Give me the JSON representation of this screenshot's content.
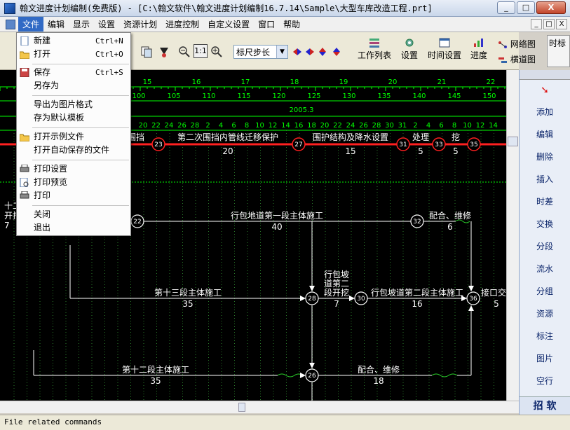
{
  "window": {
    "title": "翰文进度计划编制(免费版) - [C:\\翰文软件\\翰文进度计划编制16.7.14\\Sample\\大型车库改造工程.prt]",
    "min": "_",
    "max": "□",
    "close": "X"
  },
  "menu": {
    "items": [
      "文件",
      "编辑",
      "显示",
      "设置",
      "资源计划",
      "进度控制",
      "自定义设置",
      "窗口",
      "帮助"
    ],
    "mdi": [
      "_",
      "□",
      "X"
    ]
  },
  "file_menu": {
    "items": [
      {
        "label": "新建",
        "shortcut": "Ctrl+N",
        "icon": "new-file-icon"
      },
      {
        "label": "打开",
        "shortcut": "Ctrl+O",
        "icon": "open-folder-icon"
      },
      {
        "label": "保存",
        "shortcut": "Ctrl+S",
        "icon": "save-icon"
      },
      {
        "label": "另存为",
        "shortcut": "",
        "icon": ""
      },
      {
        "label": "导出为图片格式",
        "shortcut": "",
        "icon": ""
      },
      {
        "label": "存为默认模板",
        "shortcut": "",
        "icon": ""
      },
      {
        "label": "打开示例文件",
        "shortcut": "",
        "icon": "open-folder-icon"
      },
      {
        "label": "打开自动保存的文件",
        "shortcut": "",
        "icon": ""
      },
      {
        "label": "打印设置",
        "shortcut": "",
        "icon": "printer-icon"
      },
      {
        "label": "打印预览",
        "shortcut": "",
        "icon": "preview-icon"
      },
      {
        "label": "打印",
        "shortcut": "",
        "icon": "printer-icon"
      },
      {
        "label": "关闭",
        "shortcut": "",
        "icon": ""
      },
      {
        "label": "退出",
        "shortcut": "",
        "icon": ""
      }
    ]
  },
  "toolbar": {
    "zoom_11": "1:1",
    "ruler_select": "标尺步长",
    "work_list": "工作列表",
    "settings": "设置",
    "time_settings": "时间设置",
    "progress": "进度",
    "network": "网络图",
    "bar_chart": "横道图",
    "right_cut": "时标"
  },
  "right_panel": {
    "items": [
      "添加",
      "编辑",
      "删除",
      "插入",
      "时差",
      "交换",
      "分段",
      "流水",
      "分组",
      "资源",
      "标注",
      "图片",
      "空行"
    ],
    "bottom": "招 软"
  },
  "timeline": {
    "week_labels": [
      "15",
      "16",
      "17",
      "18",
      "19",
      "20",
      "21",
      "22"
    ],
    "day_labels": [
      "100",
      "105",
      "110",
      "115",
      "120",
      "125",
      "130",
      "135",
      "140",
      "145",
      "150"
    ],
    "month_label": "2005.3",
    "date_labels": [
      "20",
      "22",
      "24",
      "26",
      "28",
      "2",
      "4",
      "6",
      "8",
      "10",
      "12",
      "14",
      "16",
      "18",
      "20",
      "22",
      "24",
      "26",
      "28",
      "30",
      "31",
      "2",
      "4",
      "6",
      "8",
      "10",
      "12",
      "14"
    ]
  },
  "network": {
    "critical_tasks": [
      {
        "name": "围挡",
        "duration": ""
      },
      {
        "name": "第二次围挡内管线迁移保护",
        "duration": "20"
      },
      {
        "name": "围护结构及降水设置",
        "duration": "15"
      },
      {
        "name": "处理",
        "duration": "5"
      },
      {
        "name": "挖",
        "duration": "5"
      }
    ],
    "critical_nodes": [
      "23",
      "27",
      "31",
      "33",
      "35"
    ],
    "tasks": [
      {
        "name": "行包地道第一段主体施工",
        "duration": "40"
      },
      {
        "name": "配合、维修",
        "duration": "6"
      },
      {
        "name": "第十三段主体施工",
        "duration": "35"
      },
      {
        "name": "行包坡",
        "duration": ""
      },
      {
        "name": "道第二",
        "duration": ""
      },
      {
        "name": "段开挖",
        "duration": "7"
      },
      {
        "name": "行包坡道第二段主体施工",
        "duration": "16"
      },
      {
        "name": "接口交",
        "duration": "5"
      },
      {
        "name": "第十二段主体施工",
        "duration": "35"
      },
      {
        "name": "配合、维修",
        "duration": "18"
      }
    ],
    "nodes": [
      "22",
      "32",
      "28",
      "30",
      "36",
      "26"
    ],
    "left_cut_labels": [
      "十二",
      "开挖",
      "7"
    ]
  },
  "status": {
    "text": "File related commands"
  },
  "colors": {
    "critical": "#ff2020",
    "normal": "#ffffff",
    "timeline": "#00ff00",
    "background": "#000000",
    "menu_highlight": "#316ac5"
  }
}
